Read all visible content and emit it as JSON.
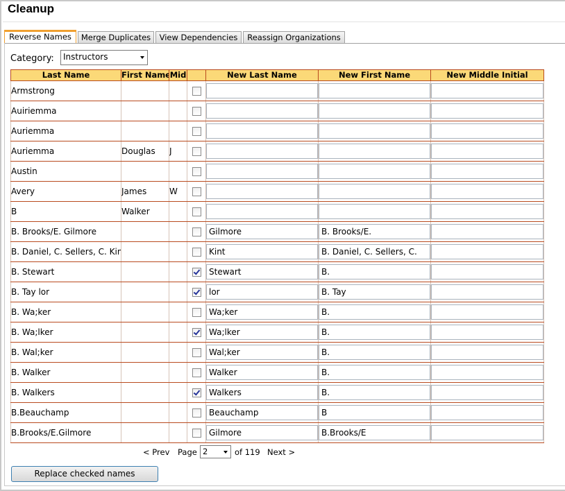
{
  "page": {
    "title": "Cleanup"
  },
  "tabs": [
    {
      "label": "Reverse Names",
      "active": true
    },
    {
      "label": "Merge Duplicates",
      "active": false
    },
    {
      "label": "View Dependencies",
      "active": false
    },
    {
      "label": "Reassign Organizations",
      "active": false
    }
  ],
  "category": {
    "label": "Category:",
    "selected": "Instructors"
  },
  "table": {
    "headers": [
      "Last Name",
      "First Name",
      "Mid",
      "",
      "New Last Name",
      "New First Name",
      "New Middle Initial"
    ],
    "rows": [
      {
        "last": "Armstrong",
        "first": "",
        "mid": "",
        "checked": false,
        "new_last": "",
        "new_first": "",
        "new_mid": ""
      },
      {
        "last": "Auiriemma",
        "first": "",
        "mid": "",
        "checked": false,
        "new_last": "",
        "new_first": "",
        "new_mid": ""
      },
      {
        "last": "Auriemma",
        "first": "",
        "mid": "",
        "checked": false,
        "new_last": "",
        "new_first": "",
        "new_mid": ""
      },
      {
        "last": "Auriemma",
        "first": "Douglas",
        "mid": "J",
        "checked": false,
        "new_last": "",
        "new_first": "",
        "new_mid": ""
      },
      {
        "last": "Austin",
        "first": "",
        "mid": "",
        "checked": false,
        "new_last": "",
        "new_first": "",
        "new_mid": ""
      },
      {
        "last": "Avery",
        "first": "James",
        "mid": "W",
        "checked": false,
        "new_last": "",
        "new_first": "",
        "new_mid": ""
      },
      {
        "last": "B",
        "first": "Walker",
        "mid": "",
        "checked": false,
        "new_last": "",
        "new_first": "",
        "new_mid": ""
      },
      {
        "last": "B. Brooks/E. Gilmore",
        "first": "",
        "mid": "",
        "checked": false,
        "new_last": "Gilmore",
        "new_first": "B. Brooks/E.",
        "new_mid": ""
      },
      {
        "last": "B. Daniel, C. Sellers, C. Kint",
        "first": "",
        "mid": "",
        "checked": false,
        "new_last": "Kint",
        "new_first": "B. Daniel, C. Sellers, C.",
        "new_mid": ""
      },
      {
        "last": "B. Stewart",
        "first": "",
        "mid": "",
        "checked": true,
        "new_last": "Stewart",
        "new_first": "B.",
        "new_mid": ""
      },
      {
        "last": "B. Tay lor",
        "first": "",
        "mid": "",
        "checked": true,
        "new_last": "lor",
        "new_first": "B. Tay",
        "new_mid": ""
      },
      {
        "last": "B. Wa;ker",
        "first": "",
        "mid": "",
        "checked": false,
        "new_last": "Wa;ker",
        "new_first": "B.",
        "new_mid": ""
      },
      {
        "last": "B. Wa;lker",
        "first": "",
        "mid": "",
        "checked": true,
        "new_last": "Wa;lker",
        "new_first": "B.",
        "new_mid": ""
      },
      {
        "last": "B. Wal;ker",
        "first": "",
        "mid": "",
        "checked": false,
        "new_last": "Wal;ker",
        "new_first": "B.",
        "new_mid": ""
      },
      {
        "last": "B. Walker",
        "first": "",
        "mid": "",
        "checked": false,
        "new_last": "Walker",
        "new_first": "B.",
        "new_mid": ""
      },
      {
        "last": "B. Walkers",
        "first": "",
        "mid": "",
        "checked": true,
        "new_last": "Walkers",
        "new_first": "B.",
        "new_mid": ""
      },
      {
        "last": "B.Beauchamp",
        "first": "",
        "mid": "",
        "checked": false,
        "new_last": "Beauchamp",
        "new_first": "B",
        "new_mid": ""
      },
      {
        "last": "B.Brooks/E.Gilmore",
        "first": "",
        "mid": "",
        "checked": false,
        "new_last": "Gilmore",
        "new_first": "B.Brooks/E",
        "new_mid": ""
      }
    ]
  },
  "pager": {
    "prev_label": "< Prev",
    "page_label": "Page",
    "current_page": "2",
    "of_label": "of 119",
    "next_label": "Next >"
  },
  "actions": {
    "replace_label": "Replace checked names"
  },
  "colors": {
    "header_bg": "#fbd978",
    "grid_border": "#b94a1e",
    "active_tab": "#f0a030",
    "link": "#0000cc"
  }
}
